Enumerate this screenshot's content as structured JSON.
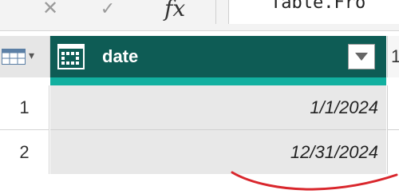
{
  "formula_bar": {
    "cancel_icon": "x-icon",
    "confirm_icon": "check-icon",
    "fx_label": "fx",
    "formula_text": "Table.Fro"
  },
  "table": {
    "corner_icon": "table-icon",
    "columns": [
      {
        "name": "date",
        "type_icon": "calendar-icon"
      }
    ],
    "next_column_fragment": "1",
    "rows": [
      {
        "num": "1",
        "date": "1/1/2024"
      },
      {
        "num": "2",
        "date": "12/31/2024"
      }
    ]
  },
  "colors": {
    "header_bg": "#0e5c55",
    "quality_bar": "#12b0a0",
    "cell_bg": "#e8e8e8",
    "annotation": "#d9262c"
  }
}
